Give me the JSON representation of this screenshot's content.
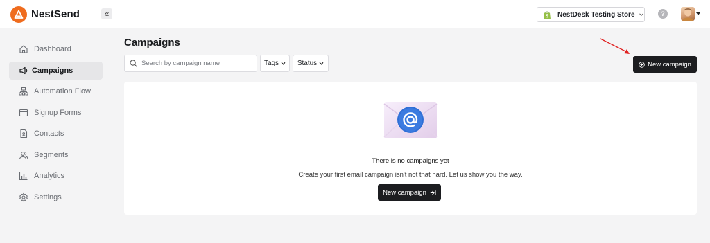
{
  "app": {
    "name": "NestSend"
  },
  "header": {
    "collapse_glyph": "«",
    "store_name": "NestDesk Testing Store",
    "help_glyph": "?"
  },
  "sidebar": {
    "items": [
      {
        "label": "Dashboard",
        "icon": "home-icon",
        "active": false
      },
      {
        "label": "Campaigns",
        "icon": "megaphone-icon",
        "active": true
      },
      {
        "label": "Automation Flow",
        "icon": "flow-icon",
        "active": false
      },
      {
        "label": "Signup Forms",
        "icon": "form-icon",
        "active": false
      },
      {
        "label": "Contacts",
        "icon": "contacts-icon",
        "active": false
      },
      {
        "label": "Segments",
        "icon": "segments-icon",
        "active": false
      },
      {
        "label": "Analytics",
        "icon": "analytics-icon",
        "active": false
      },
      {
        "label": "Settings",
        "icon": "gear-icon",
        "active": false
      }
    ]
  },
  "main": {
    "title": "Campaigns",
    "search_placeholder": "Search by campaign name",
    "filters": {
      "tags": "Tags",
      "status": "Status"
    },
    "new_campaign_label": "New campaign",
    "empty_state": {
      "title": "There is no campaigns yet",
      "subtitle": "Create your first email campaign isn't not that hard. Let us show you the way.",
      "button_label": "New campaign"
    }
  },
  "colors": {
    "brand": "#ef6c1e",
    "primary_button": "#1c1d20",
    "annotation_arrow": "#e02020",
    "envelope_icon": "#3b7be0"
  }
}
